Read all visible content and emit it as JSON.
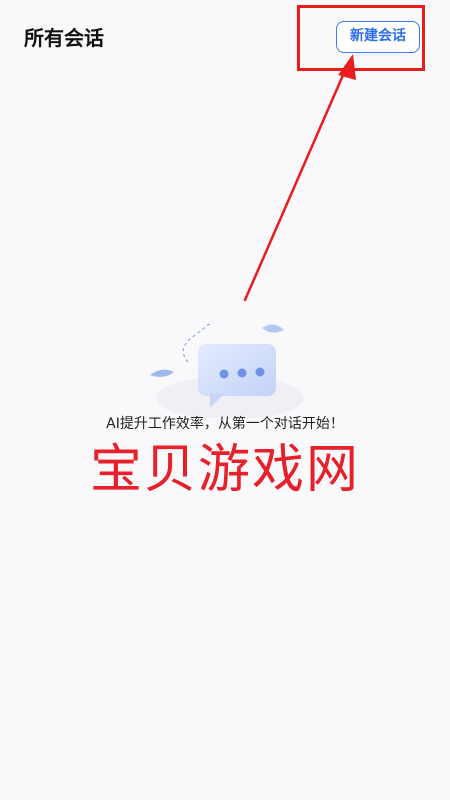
{
  "header": {
    "title": "所有会话",
    "new_chat_label": "新建会话"
  },
  "empty_state": {
    "message": "AI提升工作效率，从第一个对话开始！",
    "icon": "chat-bubble-icon"
  },
  "watermark": {
    "text": "宝贝游戏网"
  },
  "colors": {
    "accent": "#3f7bf0",
    "annotation": "#ea1c1c",
    "background": "#f9f9fc"
  }
}
